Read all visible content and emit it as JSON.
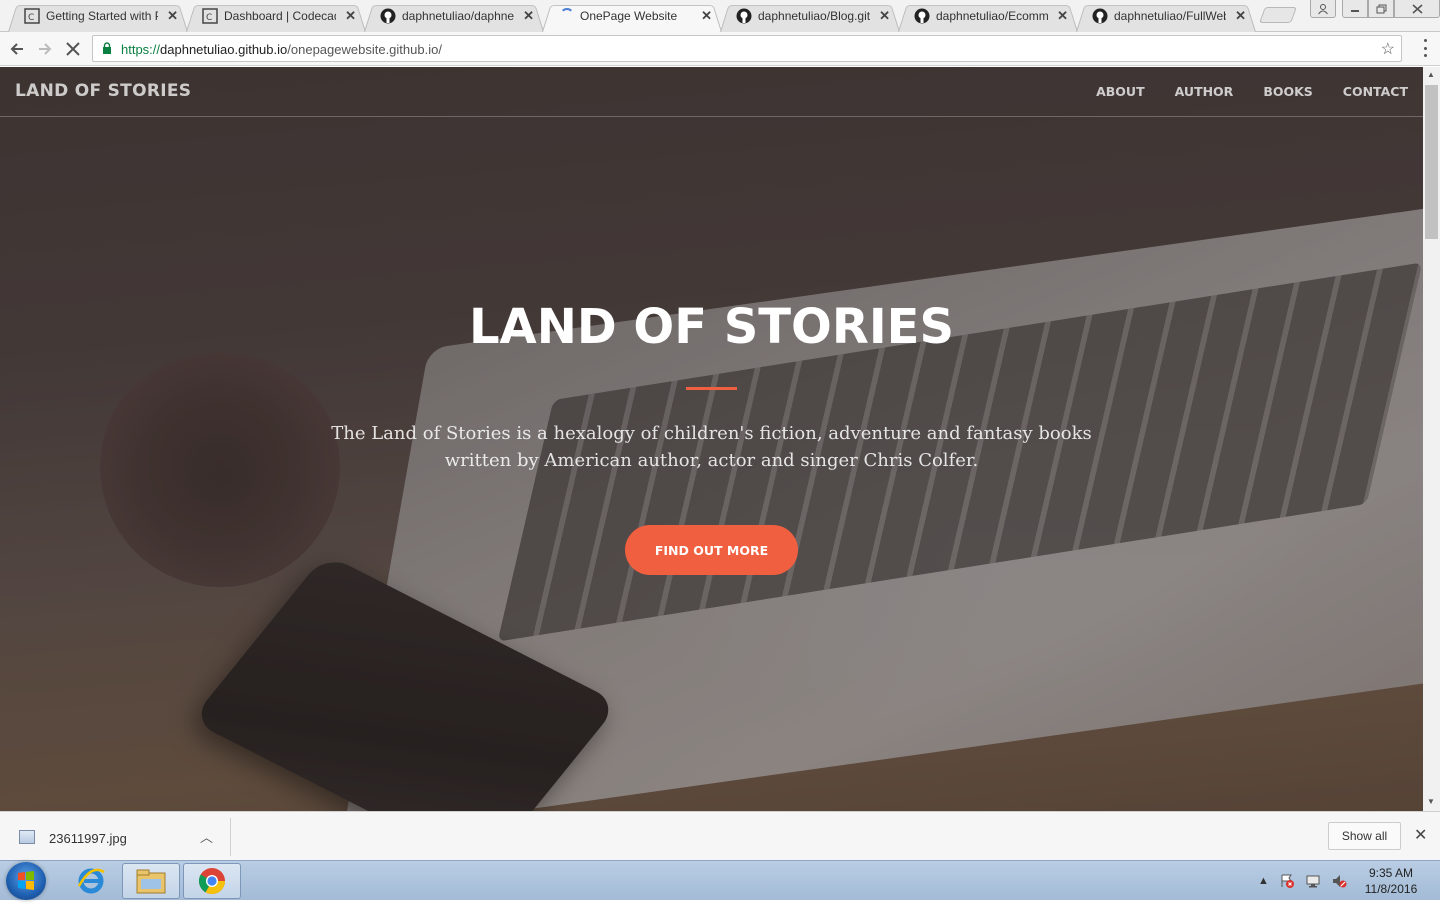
{
  "tabs": [
    {
      "title": "Getting Started with P",
      "icon": "codecademy-icon"
    },
    {
      "title": "Dashboard | Codecade",
      "icon": "codecademy-icon"
    },
    {
      "title": "daphnetuliao/daphne",
      "icon": "github-icon"
    },
    {
      "title": "OnePage Website",
      "icon": "loading-spinner",
      "active": true
    },
    {
      "title": "daphnetuliao/Blog.git",
      "icon": "github-icon"
    },
    {
      "title": "daphnetuliao/Ecomm",
      "icon": "github-icon"
    },
    {
      "title": "daphnetuliao/FullWeb",
      "icon": "github-icon"
    }
  ],
  "toolbar": {
    "url_protocol": "https://",
    "url_host": "daphnetuliao.github.io",
    "url_path": "/onepagewebsite.github.io/"
  },
  "site": {
    "brand": "LAND OF STORIES",
    "nav": [
      "ABOUT",
      "AUTHOR",
      "BOOKS",
      "CONTACT"
    ],
    "hero_title": "LAND OF STORIES",
    "hero_text": "The Land of Stories is a hexalogy of children's fiction, adventure and fantasy books written by American author, actor and singer Chris Colfer.",
    "cta_label": "FIND OUT MORE",
    "accent_color": "#f05f40"
  },
  "downloads": {
    "filename": "23611997.jpg",
    "show_all": "Show all"
  },
  "taskbar": {
    "time": "9:35 AM",
    "date": "11/8/2016"
  }
}
